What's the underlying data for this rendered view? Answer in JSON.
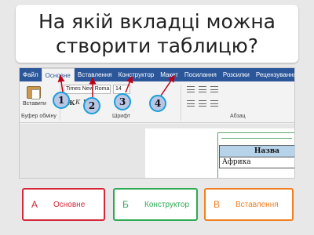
{
  "question": {
    "text": "На якій вкладці можна створити таблицю?"
  },
  "word": {
    "tabs": [
      "Файл",
      "Основне",
      "Вставлення",
      "Конструктор",
      "Макет",
      "Посилання",
      "Розсилки",
      "Рецензування"
    ],
    "active_tab": "Основне",
    "paste_label": "Вставити",
    "font_name": "Times New Roma",
    "font_size": "14",
    "format_buttons": [
      "Ж",
      "К",
      "П"
    ],
    "groups": {
      "clipboard": "Буфер обміну",
      "font": "Шрифт",
      "paragraph": "Абзац"
    },
    "table": {
      "header": "Назва",
      "cell": "Африка"
    },
    "colors": {
      "ribbon_tab_bar": "#2b579a",
      "marker_arrow": "#c0001a"
    }
  },
  "markers": [
    "1",
    "2",
    "3",
    "4"
  ],
  "answers": [
    {
      "letter": "А",
      "text": "Основне",
      "color": "#d62839"
    },
    {
      "letter": "Б",
      "text": "Конструктор",
      "color": "#2eaa54"
    },
    {
      "letter": "В",
      "text": "Вставлення",
      "color": "#f07f22"
    }
  ]
}
